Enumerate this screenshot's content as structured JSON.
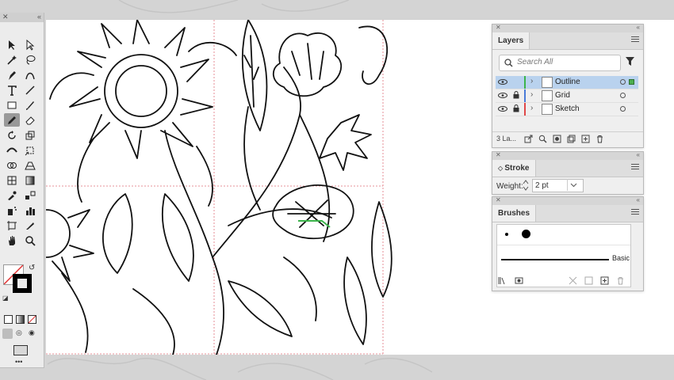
{
  "layers": {
    "title": "Layers",
    "search_placeholder": "Search All",
    "rows": [
      {
        "name": "Outline",
        "color": "#3cb44b",
        "selected": true,
        "locked": false
      },
      {
        "name": "Grid",
        "color": "#4a7bd8",
        "selected": false,
        "locked": true
      },
      {
        "name": "Sketch",
        "color": "#e04848",
        "selected": false,
        "locked": true
      }
    ],
    "count": "3 La..."
  },
  "stroke": {
    "title": "Stroke",
    "weight_label": "Weight:",
    "weight_value": "2 pt"
  },
  "brushes": {
    "title": "Brushes",
    "basic_label": "Basic"
  },
  "tools_more": "•••",
  "colors": {
    "selection_green": "#3cb44b",
    "layer_selected_bg": "#b9d2ee",
    "guide_red": "#e0707a"
  },
  "icons": [
    "selection-icon",
    "direct-selection-icon",
    "magic-wand-icon",
    "lasso-icon",
    "pen-icon",
    "curvature-icon",
    "type-icon",
    "line-icon",
    "rectangle-icon",
    "paintbrush-icon",
    "pencil-icon",
    "eraser-icon",
    "rotate-icon",
    "scale-icon",
    "width-icon",
    "free-transform-icon",
    "shape-builder-icon",
    "perspective-icon",
    "mesh-icon",
    "gradient-icon",
    "eyedropper-icon",
    "blend-icon",
    "symbol-sprayer-icon",
    "column-graph-icon",
    "artboard-icon",
    "slice-icon",
    "hand-icon",
    "zoom-icon",
    "eye-icon",
    "lock-icon",
    "filter-icon"
  ]
}
